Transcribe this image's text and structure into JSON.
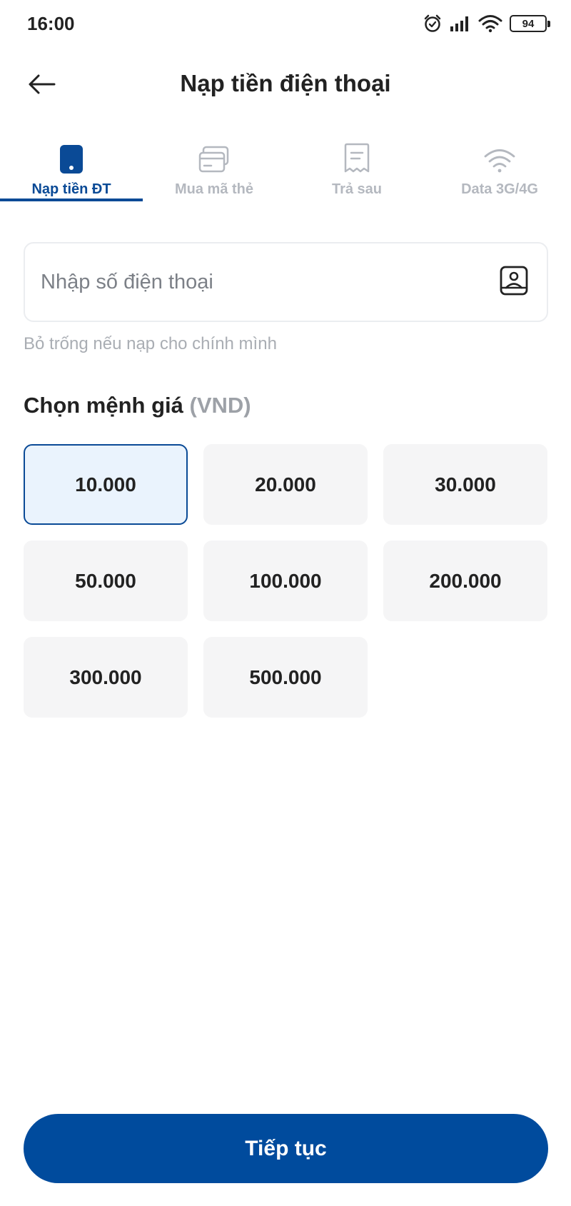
{
  "status_bar": {
    "time": "16:00",
    "battery_level": "94",
    "icons": [
      "alarm-icon",
      "signal-icon",
      "wifi-icon",
      "battery-icon"
    ]
  },
  "header": {
    "title": "Nạp tiền điện thoại",
    "back_icon": "arrow-left-icon"
  },
  "tabs": [
    {
      "label": "Nạp tiền ĐT",
      "icon": "phone-icon",
      "active": true
    },
    {
      "label": "Mua mã thẻ",
      "icon": "card-icon",
      "active": false
    },
    {
      "label": "Trả sau",
      "icon": "receipt-icon",
      "active": false
    },
    {
      "label": "Data 3G/4G",
      "icon": "wifi-icon",
      "active": false
    }
  ],
  "phone": {
    "value": "",
    "placeholder": "Nhập số điện thoại",
    "contact_icon": "contact-book-icon",
    "hint": "Bỏ trống nếu nạp cho chính mình"
  },
  "denomination": {
    "title": "Chọn mệnh giá",
    "unit": "(VND)",
    "selected": "10.000",
    "options": [
      "10.000",
      "20.000",
      "30.000",
      "50.000",
      "100.000",
      "200.000",
      "300.000",
      "500.000"
    ]
  },
  "footer": {
    "continue_label": "Tiếp tục"
  },
  "colors": {
    "primary": "#0a4a96",
    "button": "#004b9d",
    "selected_bg": "#eaf3fd",
    "tab_inactive": "#b4b8bf",
    "option_bg": "#f5f5f6"
  }
}
